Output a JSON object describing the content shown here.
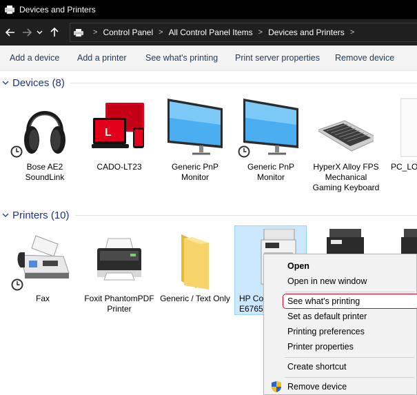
{
  "window": {
    "title": "Devices and Printers"
  },
  "address": {
    "crumbs": [
      "Control Panel",
      "All Control Panel Items",
      "Devices and Printers"
    ]
  },
  "toolbar": {
    "add_device": "Add a device",
    "add_printer": "Add a printer",
    "see_printing": "See what's printing",
    "print_server": "Print server properties",
    "remove_device": "Remove device"
  },
  "devices": {
    "header": "Devices (8)",
    "items": [
      {
        "label": "Bose AE2 SoundLink",
        "icon": "headphones-icon"
      },
      {
        "label": "CADO-LT23",
        "icon": "laptop-icon"
      },
      {
        "label": "Generic PnP Monitor",
        "icon": "monitor-icon"
      },
      {
        "label": "Generic PnP Monitor",
        "icon": "monitor-icon"
      },
      {
        "label": "HyperX Alloy FPS Mechanical Gaming Keyboard",
        "icon": "keyboard-icon"
      },
      {
        "label": "PC_LO",
        "icon": "computer-icon"
      }
    ]
  },
  "printers": {
    "header": "Printers (10)",
    "items": [
      {
        "label": "Fax",
        "icon": "fax-icon"
      },
      {
        "label": "Foxit PhantomPDF Printer",
        "icon": "printer-icon"
      },
      {
        "label": "Generic / Text Only",
        "icon": "folder-icon"
      },
      {
        "label": "HP Co",
        "label2": "E6765",
        "icon": "mfp-printer-icon"
      }
    ]
  },
  "context_menu": {
    "open": "Open",
    "open_new": "Open in new window",
    "see_printing": "See what's printing",
    "set_default": "Set as default printer",
    "prefs": "Printing preferences",
    "props": "Printer properties",
    "shortcut": "Create shortcut",
    "remove": "Remove device"
  },
  "colors": {
    "group_header": "#1e3287",
    "command_text": "#1e395b",
    "selection": "#cce8ff",
    "highlight_border": "#e0001b"
  }
}
